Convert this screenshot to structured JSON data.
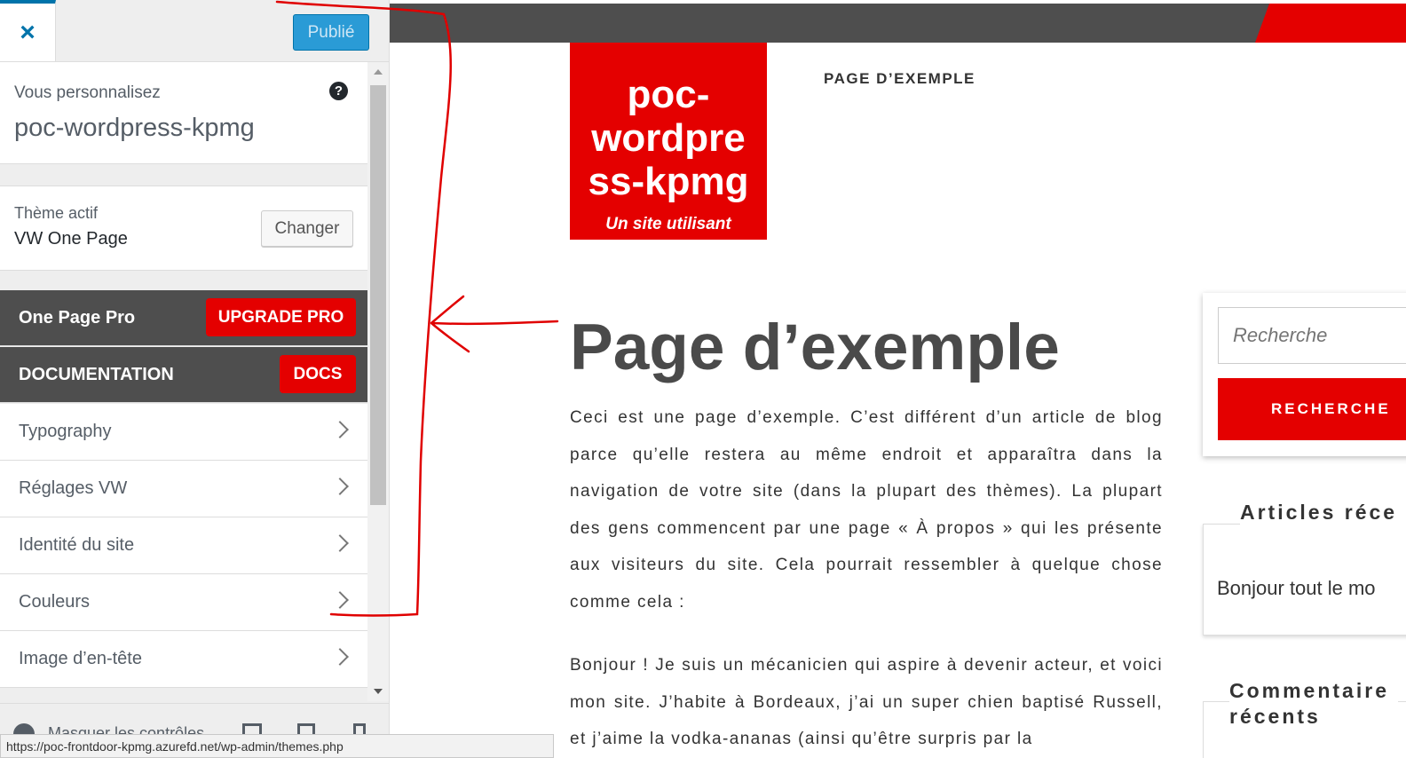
{
  "sidebar": {
    "close_icon": "×",
    "publish_label": "Publié",
    "customizing_label": "Vous personnalisez",
    "site_name": "poc-wordpress-kpmg",
    "help_icon": "?",
    "theme_active_label": "Thème actif",
    "theme_name": "VW One Page",
    "change_label": "Changer",
    "promo_rows": [
      {
        "label": "One Page Pro",
        "button": "UPGRADE PRO"
      },
      {
        "label": "DOCUMENTATION",
        "button": "DOCS"
      }
    ],
    "sections": [
      {
        "label": "Typography"
      },
      {
        "label": "Réglages VW"
      },
      {
        "label": "Identité du site"
      },
      {
        "label": "Couleurs"
      },
      {
        "label": "Image d’en-tête"
      }
    ],
    "collapse_label": "Masquer les contrôles"
  },
  "status_bar": {
    "url": "https://poc-frontdoor-kpmg.azurefd.net/wp-admin/themes.php"
  },
  "preview": {
    "logo_title": "poc-wordpress-kpmg",
    "logo_title_lines": [
      "poc-",
      "wordpre",
      "ss-kpmg"
    ],
    "logo_tagline": "Un site utilisant",
    "nav_link": "PAGE D’EXEMPLE",
    "page_title": "Page d’exemple",
    "paragraphs": [
      "Ceci est une page d’exemple. C’est différent d’un article de blog parce qu’elle restera au même endroit et apparaîtra dans la navigation de votre site (dans la plupart des thèmes). La plupart des gens commencent par une page « À propos » qui les présente aux visiteurs du site. Cela pourrait ressembler à quelque chose comme cela :",
      "Bonjour ! Je suis un mécanicien qui aspire à devenir acteur, et voici mon site. J’habite à Bordeaux, j’ai un super chien baptisé Russell, et j’aime la vodka-ananas (ainsi qu’être surpris par la"
    ],
    "search_placeholder": "Recherche",
    "search_button": "RECHERCHE",
    "recent_articles_title": "Articles réce",
    "recent_article_item": "Bonjour tout le mo",
    "recent_comments_title": "Commentaire\nrécents"
  },
  "colors": {
    "accent_red": "#e40000",
    "dark_bar": "#4e4e4e",
    "wp_blue": "#0073aa",
    "annotation_red": "#e00000"
  },
  "icons": {
    "close": "close-icon",
    "help": "help-icon",
    "chevron": "chevron-right-icon",
    "collapse": "collapse-icon",
    "devices": [
      "desktop-icon",
      "tablet-icon",
      "mobile-icon"
    ]
  }
}
